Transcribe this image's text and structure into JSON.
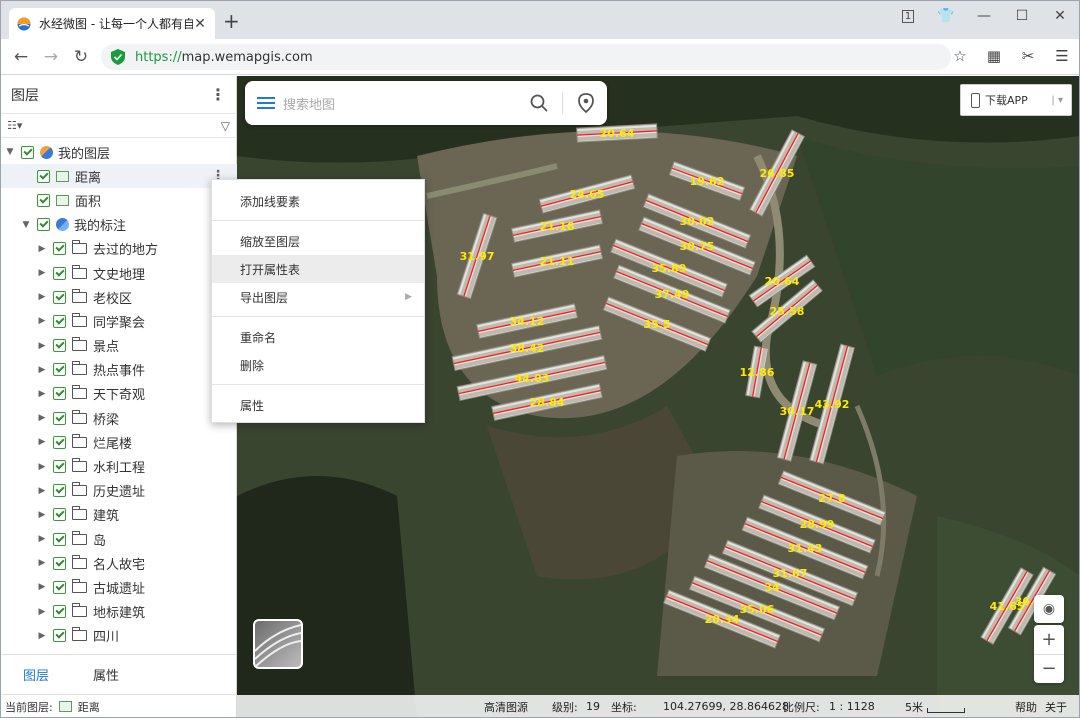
{
  "browser": {
    "tab_title": "水经微图 - 让每一个人都有自",
    "url_protocol": "https://",
    "url_host": "map.wemapgis.com",
    "tab_badge": "1"
  },
  "sidebar": {
    "title": "图层",
    "root": "我的图层",
    "layers": [
      "距离",
      "面积"
    ],
    "group": "我的标注",
    "folders": [
      "去过的地方",
      "文史地理",
      "老校区",
      "同学聚会",
      "景点",
      "热点事件",
      "天下奇观",
      "桥梁",
      "烂尾楼",
      "水利工程",
      "历史遗址",
      "建筑",
      "岛",
      "名人故宅",
      "古城遗址",
      "地标建筑",
      "四川"
    ],
    "tabs": [
      "图层",
      "属性"
    ],
    "current_label": "当前图层:",
    "current_value": "距离"
  },
  "context_menu": {
    "items": [
      "添加线要素",
      "缩放至图层",
      "打开属性表",
      "导出图层",
      "重命名",
      "删除",
      "属性"
    ],
    "highlighted": "打开属性表"
  },
  "map": {
    "search_placeholder": "搜索地图",
    "download": "下载APP",
    "status": {
      "source": "高清图源",
      "level_label": "级别:",
      "level": "19",
      "coord_label": "坐标:",
      "coord": "104.27699, 28.864628",
      "scale_label": "比例尺:",
      "scale": "1 : 1128",
      "scalebar": "5米",
      "help": "帮助",
      "about": "关于"
    },
    "measurements": [
      "20.64",
      "19.62",
      "26.85",
      "24.65",
      "30.02",
      "21.16",
      "31.97",
      "30.75",
      "21.11",
      "35.89",
      "20.64",
      "37.49",
      "25.58",
      "34.12",
      "35.5",
      "38.42",
      "12.86",
      "44.03",
      "30.17",
      "43.92",
      "28.84",
      "27.8",
      "28.99",
      "31.43",
      "31.67",
      "34",
      "35.06",
      "20.34",
      "36.99",
      "41.65"
    ]
  }
}
